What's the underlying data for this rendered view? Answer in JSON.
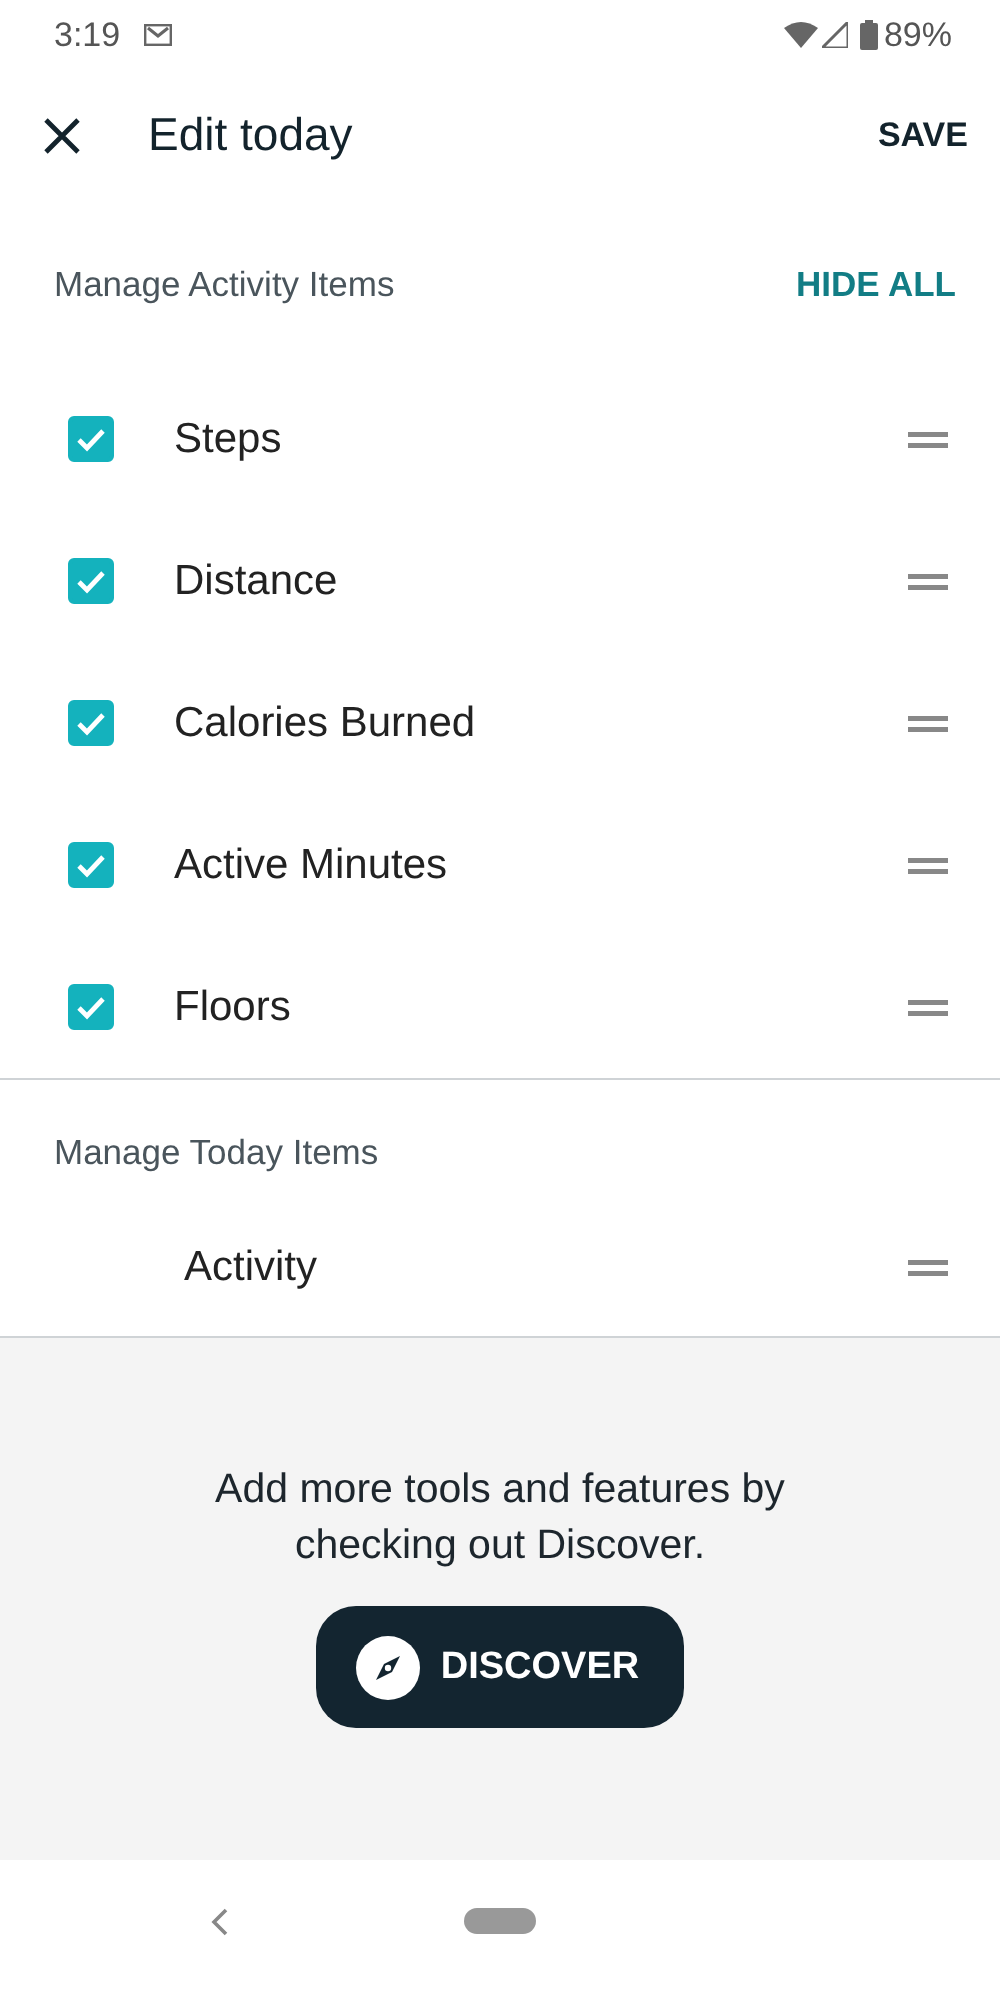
{
  "status_bar": {
    "time": "3:19",
    "battery": "89%"
  },
  "app_bar": {
    "title": "Edit today",
    "action": "SAVE"
  },
  "activity_section": {
    "title": "Manage Activity Items",
    "action": "HIDE ALL",
    "items": [
      {
        "label": "Steps",
        "checked": true
      },
      {
        "label": "Distance",
        "checked": true
      },
      {
        "label": "Calories Burned",
        "checked": true
      },
      {
        "label": "Active Minutes",
        "checked": true
      },
      {
        "label": "Floors",
        "checked": true
      }
    ]
  },
  "today_section": {
    "title": "Manage Today Items",
    "items": [
      {
        "label": "Activity"
      }
    ]
  },
  "discover": {
    "text": "Add more tools and features by checking out Discover.",
    "button": "DISCOVER"
  }
}
